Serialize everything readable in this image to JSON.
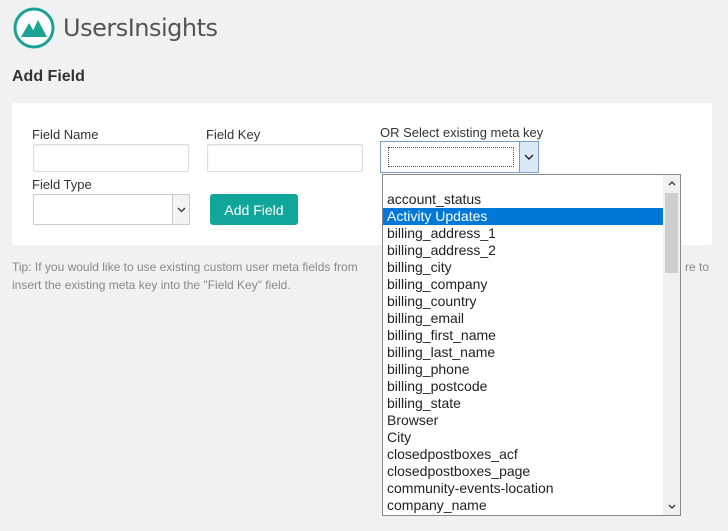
{
  "app": {
    "brand": "UsersInsights"
  },
  "page": {
    "title": "Add Field"
  },
  "form": {
    "field_name_label": "Field Name",
    "field_name_value": "",
    "field_key_label": "Field Key",
    "field_key_value": "",
    "meta_key_label": "OR Select existing meta key",
    "meta_key_value": "",
    "field_type_label": "Field Type",
    "field_type_value": "",
    "add_button": "Add Field"
  },
  "tip": {
    "text": "Tip: If you would like to use existing custom user meta fields from",
    "text_right_1": "re to",
    "text_line2": "insert the existing meta key into the \"Field Key\" field."
  },
  "dropdown": {
    "options": [
      "account_status",
      "Activity Updates",
      "billing_address_1",
      "billing_address_2",
      "billing_city",
      "billing_company",
      "billing_country",
      "billing_email",
      "billing_first_name",
      "billing_last_name",
      "billing_phone",
      "billing_postcode",
      "billing_state",
      "Browser",
      "City",
      "closedpostboxes_acf",
      "closedpostboxes_page",
      "community-events-location",
      "company_name"
    ],
    "highlighted": "Activity Updates"
  },
  "colors": {
    "accent": "#12a69a",
    "selection": "#0078d7",
    "background": "#f1f1f1"
  },
  "icons": {
    "logo": "mountain-logo-icon",
    "select_arrow": "chevron-down-icon",
    "scroll_up": "chevron-up-icon",
    "scroll_down": "chevron-down-icon"
  }
}
